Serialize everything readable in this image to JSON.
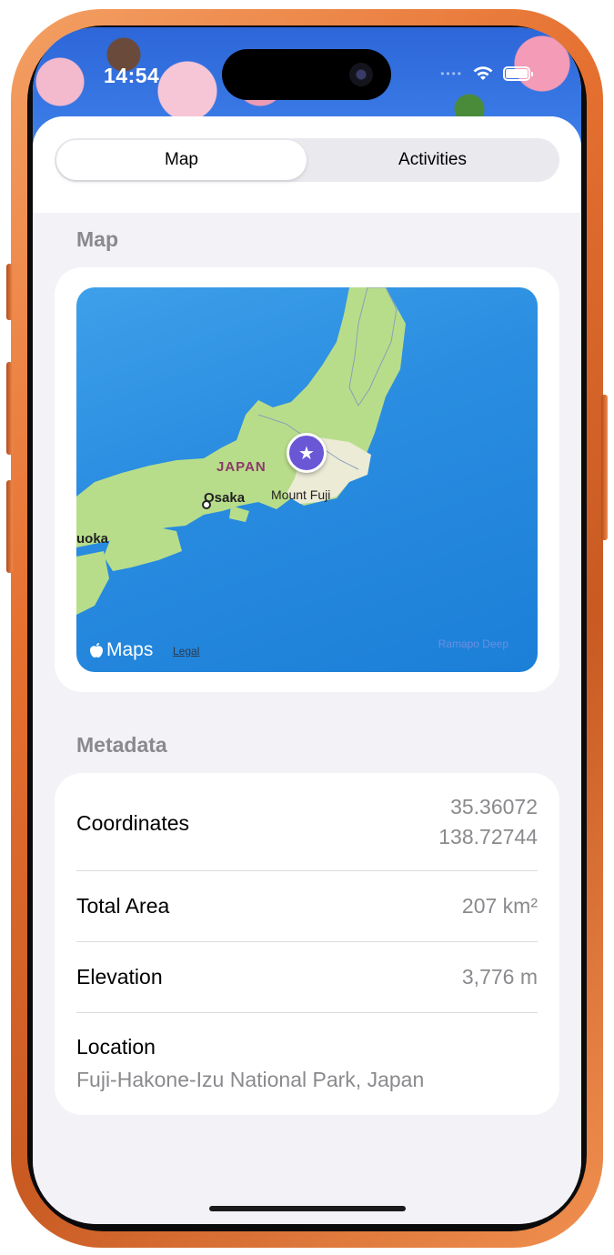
{
  "status": {
    "time": "14:54"
  },
  "tabs": [
    {
      "label": "Map",
      "selected": true
    },
    {
      "label": "Activities",
      "selected": false
    }
  ],
  "map_section": {
    "title": "Map",
    "labels": {
      "japan": "JAPAN",
      "osaka": "Osaka",
      "mount_fuji": "Mount Fuji",
      "fukuoka": "uoka",
      "maps": "Maps",
      "legal": "Legal",
      "deep": "Ramapo Deep"
    }
  },
  "metadata": {
    "title": "Metadata",
    "coordinates_label": "Coordinates",
    "latitude": "35.36072",
    "longitude": "138.72744",
    "area_label": "Total Area",
    "area_value": "207 km²",
    "elevation_label": "Elevation",
    "elevation_value": "3,776 m",
    "location_label": "Location",
    "location_value": "Fuji-Hakone-Izu National Park, Japan"
  },
  "colors": {
    "accent_pin": "#6a57d6",
    "secondary_text": "#8a8a8e",
    "background": "#f2f2f7"
  }
}
